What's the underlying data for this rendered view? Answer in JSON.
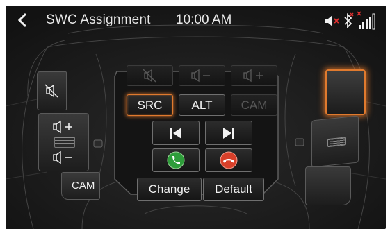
{
  "header": {
    "title": "SWC Assignment",
    "time": "10:00 AM",
    "back_icon": "chevron-left-icon",
    "status_icons": [
      "speaker-muted-icon",
      "bluetooth-off-icon",
      "signal-no-service-icon"
    ]
  },
  "center_panel": {
    "volume_buttons": [
      {
        "icon": "mute-icon",
        "enabled": false
      },
      {
        "icon": "volume-down-icon",
        "enabled": false
      },
      {
        "icon": "volume-up-icon",
        "enabled": false
      }
    ],
    "source_buttons": [
      {
        "label": "SRC",
        "selected": true,
        "enabled": true
      },
      {
        "label": "ALT",
        "selected": false,
        "enabled": true
      },
      {
        "label": "CAM",
        "selected": false,
        "enabled": false
      }
    ],
    "track_buttons": [
      {
        "icon": "skip-previous-icon"
      },
      {
        "icon": "skip-next-icon"
      }
    ],
    "call_buttons": [
      {
        "icon": "phone-answer-icon",
        "color": "#2e9d3a"
      },
      {
        "icon": "phone-hangup-icon",
        "color": "#d8402a"
      }
    ],
    "change_label": "Change",
    "default_label": "Default"
  },
  "left_buttons": {
    "cam_label": "CAM",
    "icons": [
      "mute-icon",
      "volume-up-icon",
      "volume-down-icon"
    ]
  },
  "colors": {
    "accent": "#e07a2e",
    "background": "#1a1a1a",
    "answer": "#2e9d3a",
    "hangup": "#d8402a"
  }
}
